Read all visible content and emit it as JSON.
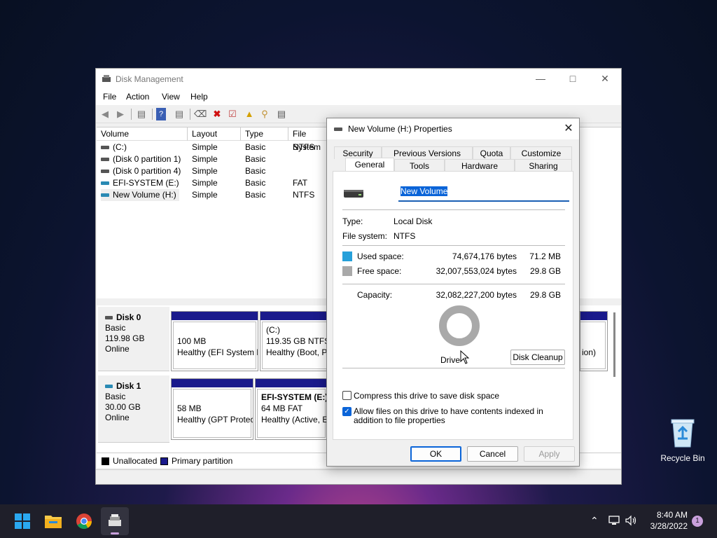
{
  "dm": {
    "title": "Disk Management",
    "menu": [
      "File",
      "Action",
      "View",
      "Help"
    ],
    "columns": [
      "Volume",
      "Layout",
      "Type",
      "File System"
    ],
    "rows": [
      {
        "volume": "(C:)",
        "layout": "Simple",
        "type": "Basic",
        "fs": "NTFS"
      },
      {
        "volume": "(Disk 0 partition 1)",
        "layout": "Simple",
        "type": "Basic",
        "fs": ""
      },
      {
        "volume": "(Disk 0 partition 4)",
        "layout": "Simple",
        "type": "Basic",
        "fs": ""
      },
      {
        "volume": "EFI-SYSTEM (E:)",
        "layout": "Simple",
        "type": "Basic",
        "fs": "FAT"
      },
      {
        "volume": "New Volume (H:)",
        "layout": "Simple",
        "type": "Basic",
        "fs": "NTFS"
      }
    ],
    "disks": [
      {
        "name": "Disk 0",
        "kind": "Basic",
        "size": "119.98 GB",
        "status": "Online",
        "parts": [
          {
            "title": "",
            "line1": "100 MB",
            "line2": "Healthy (EFI System P"
          },
          {
            "title": "(C:)",
            "line1": "119.35 GB NTFS",
            "line2": "Healthy (Boot, Pa"
          },
          {
            "title": "",
            "line1": "",
            "line2": "ion)"
          }
        ]
      },
      {
        "name": "Disk 1",
        "kind": "Basic",
        "size": "30.00 GB",
        "status": "Online",
        "parts": [
          {
            "title": "",
            "line1": "58 MB",
            "line2": "Healthy (GPT Protec"
          },
          {
            "title": "EFI-SYSTEM  (E:)",
            "line1": "64 MB FAT",
            "line2": "Healthy (Active, EF"
          }
        ]
      }
    ],
    "legend": {
      "unallocated": "Unallocated",
      "primary": "Primary partition"
    }
  },
  "dialog": {
    "title": "New Volume (H:) Properties",
    "tabs_row1": [
      "Security",
      "Previous Versions",
      "Quota",
      "Customize"
    ],
    "tabs_row2": [
      "General",
      "Tools",
      "Hardware",
      "Sharing"
    ],
    "volume_name": "New Volume",
    "type_label": "Type:",
    "type_value": "Local Disk",
    "fs_label": "File system:",
    "fs_value": "NTFS",
    "used_label": "Used space:",
    "used_bytes": "74,674,176 bytes",
    "used_size": "71.2 MB",
    "free_label": "Free space:",
    "free_bytes": "32,007,553,024 bytes",
    "free_size": "29.8 GB",
    "cap_label": "Capacity:",
    "cap_bytes": "32,082,227,200 bytes",
    "cap_size": "29.8 GB",
    "drive_label": "Drive",
    "cleanup": "Disk Cleanup",
    "compress": "Compress this drive to save disk space",
    "index": "Allow files on this drive to have contents indexed in addition to file properties",
    "ok": "OK",
    "cancel": "Cancel",
    "apply": "Apply",
    "used_color": "#26a0da",
    "free_color": "#a9a9a9"
  },
  "desktop": {
    "recycle": "Recycle Bin"
  },
  "taskbar": {
    "time": "8:40 AM",
    "date": "3/28/2022",
    "badge": "1"
  }
}
